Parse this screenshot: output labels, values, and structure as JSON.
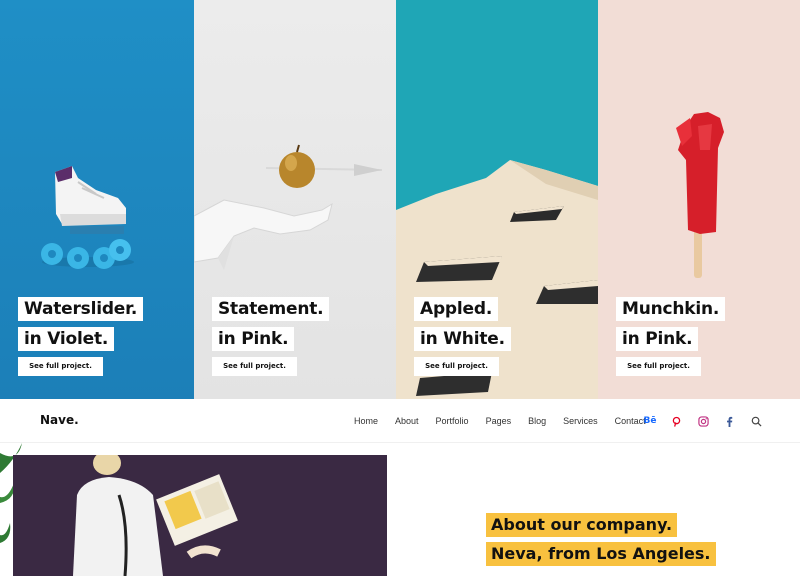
{
  "hero": {
    "panels": [
      {
        "title": "Waterslider.",
        "subtitle": "in Violet.",
        "button": "See full project."
      },
      {
        "title": "Statement.",
        "subtitle": "in Pink.",
        "button": "See full project."
      },
      {
        "title": "Appled.",
        "subtitle": "in White.",
        "button": "See full project."
      },
      {
        "title": "Munchkin.",
        "subtitle": "in Pink.",
        "button": "See full project."
      }
    ]
  },
  "nav": {
    "brand": "Nave.",
    "items": [
      "Home",
      "About",
      "Portfolio",
      "Pages",
      "Blog",
      "Services",
      "Contact"
    ],
    "socials": [
      "behance-icon",
      "pinterest-icon",
      "instagram-icon",
      "facebook-icon",
      "search-icon"
    ],
    "behance_label": "Bē"
  },
  "about": {
    "line1": "About our company.",
    "line2": "Neva, from Los Angeles."
  },
  "colors": {
    "panel1": "#1f8fc6",
    "panel2": "#e6e6e6",
    "panel3": "#1fa6b6",
    "panel4": "#f2ddd6",
    "highlight": "#f8c13f",
    "behance": "#1769ff",
    "pinterest": "#e60023",
    "instagram": "#c13584",
    "facebook": "#3b5998"
  }
}
